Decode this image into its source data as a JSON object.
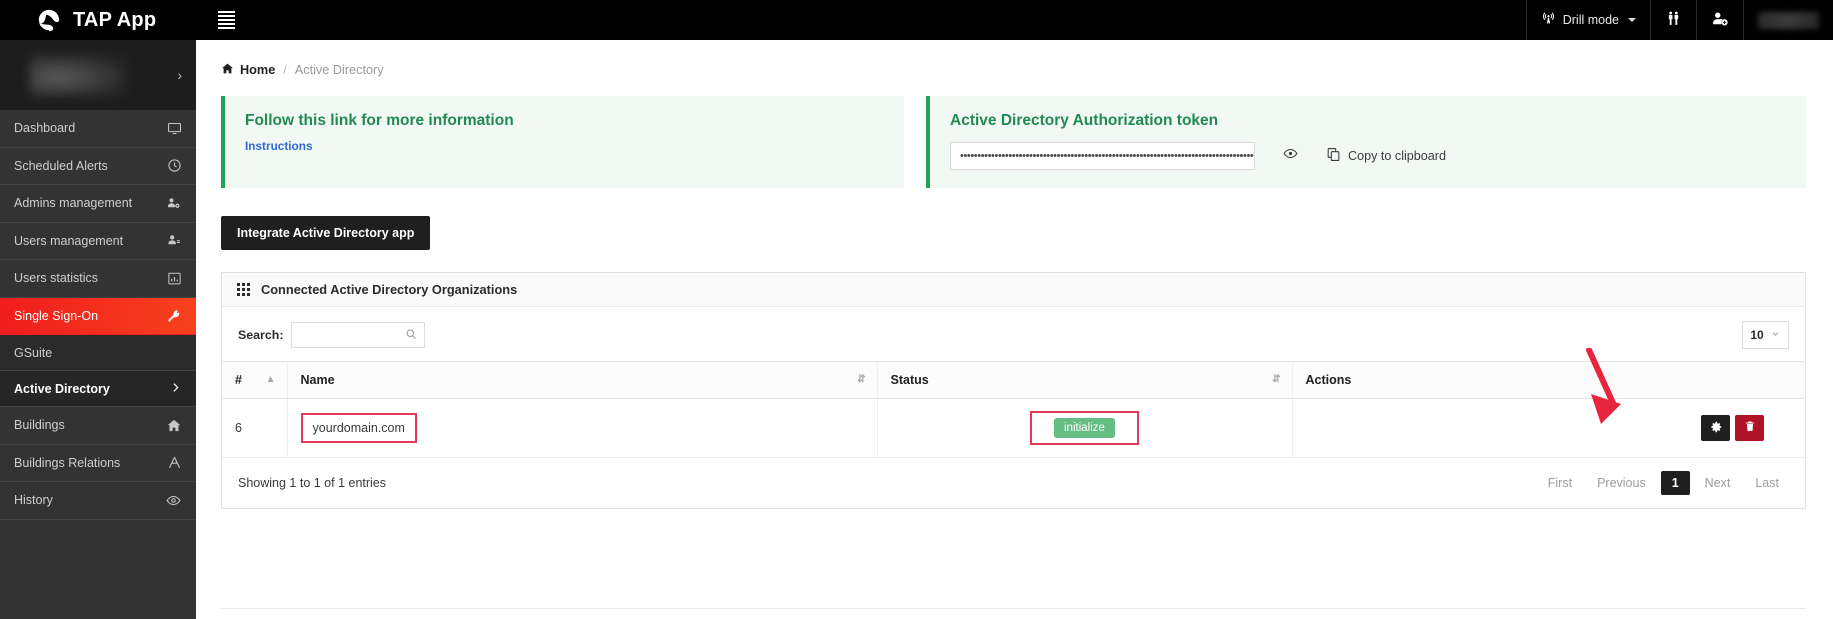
{
  "topbar": {
    "brand_name": "TAP App",
    "logo_icon": "spiral-logo-icon",
    "menu_icon": "hamburger-menu-icon",
    "drill_mode_label": "Drill mode",
    "drill_mode_icon": "broadcast-tower-icon",
    "people_icon": "two-people-icon",
    "add_user_icon": "add-user-icon",
    "avatar_icon": "user-avatar"
  },
  "sidebar": {
    "profile_icon": "profile-thumbnail",
    "profile_chevron": "›",
    "items": [
      {
        "label": "Dashboard",
        "icon": "monitor-icon",
        "icon_glyph": "⬜",
        "active": false,
        "sub": false
      },
      {
        "label": "Scheduled Alerts",
        "icon": "clock-icon",
        "icon_glyph": "◴",
        "active": false,
        "sub": false
      },
      {
        "label": "Admins management",
        "icon": "users-cog-icon",
        "icon_glyph": "⚫",
        "active": false,
        "sub": false
      },
      {
        "label": "Users management",
        "icon": "user-edit-icon",
        "icon_glyph": "⚫",
        "active": false,
        "sub": false
      },
      {
        "label": "Users statistics",
        "icon": "bar-chart-icon",
        "icon_glyph": "█",
        "active": false,
        "sub": false
      },
      {
        "label": "Single Sign-On",
        "icon": "key-icon",
        "icon_glyph": "⚿",
        "active": true,
        "sub": false
      },
      {
        "label": "GSuite",
        "icon": "",
        "icon_glyph": "",
        "active": false,
        "sub": true
      },
      {
        "label": "Active Directory",
        "icon": "chevron-right-icon",
        "icon_glyph": "›",
        "active": false,
        "sub": true,
        "current": true
      },
      {
        "label": "Buildings",
        "icon": "home-icon",
        "icon_glyph": "⌂",
        "active": false,
        "sub": false
      },
      {
        "label": "Buildings Relations",
        "icon": "sitemap-icon",
        "icon_glyph": "⑂",
        "active": false,
        "sub": false
      },
      {
        "label": "History",
        "icon": "eye-icon",
        "icon_glyph": "◉",
        "active": false,
        "sub": false
      }
    ]
  },
  "breadcrumb": {
    "home_icon": "home-icon",
    "home_label": "Home",
    "separator": "/",
    "current": "Active Directory"
  },
  "info_panel": {
    "title": "Follow this link for more information",
    "link_label": "Instructions"
  },
  "token_panel": {
    "title": "Active Directory Authorization token",
    "token_value": "••••••••••••••••••••••••••••••••••••••••••••••••••••••••••••••••••••••••••••••••••••••••••••••••••••••••••",
    "token_placeholder": "",
    "reveal_icon": "eye-icon",
    "copy_icon": "copy-icon",
    "copy_label": "Copy to clipboard"
  },
  "integrate_button": {
    "label": "Integrate Active Directory app"
  },
  "card": {
    "header_icon": "grid-dots-icon",
    "header_title": "Connected Active Directory Organizations",
    "search_label": "Search:",
    "search_value": "",
    "search_placeholder": "",
    "search_icon": "search-icon",
    "page_size": "10",
    "page_size_icon": "chevron-down-icon",
    "columns": [
      {
        "label": "#",
        "sort_icon": "sort-asc-icon"
      },
      {
        "label": "Name",
        "sort_icon": "sort-icon"
      },
      {
        "label": "Status",
        "sort_icon": "sort-icon"
      },
      {
        "label": "Actions",
        "sort_icon": ""
      }
    ],
    "rows": [
      {
        "index": "6",
        "name": "yourdomain.com",
        "status": "initialize",
        "status_color": "#65bd84",
        "actions": [
          {
            "name": "settings-button",
            "icon": "gear-icon",
            "color": "#1f1f1f"
          },
          {
            "name": "delete-button",
            "icon": "trash-icon",
            "color": "#b01326"
          }
        ]
      }
    ],
    "footer_info": "Showing 1 to 1 of 1 entries",
    "pager": {
      "first": "First",
      "previous": "Previous",
      "current_page": "1",
      "next": "Next",
      "last": "Last"
    }
  },
  "annotations": {
    "arrow_color": "#e8253f",
    "highlight_color": "#e23a55"
  }
}
